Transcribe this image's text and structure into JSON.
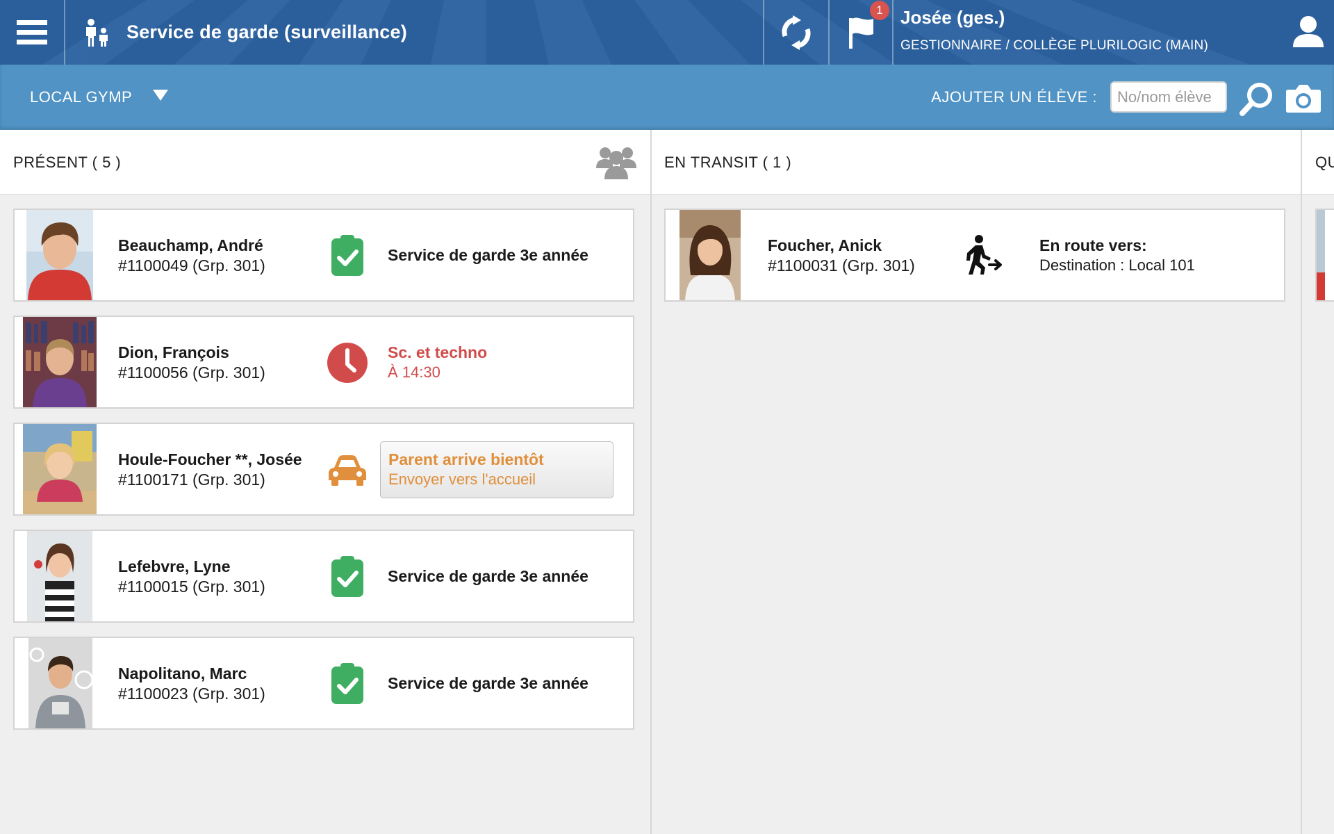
{
  "header": {
    "app_title": "Service de garde (surveillance)",
    "notification_count": "1",
    "user_name": "Josée (ges.)",
    "user_role": "GESTIONNAIRE / COLLÈGE PLURILOGIC (MAIN)"
  },
  "toolbar": {
    "location": "LOCAL GYMP",
    "add_student_label": "AJOUTER UN ÉLÈVE :",
    "student_placeholder": "No/nom élève"
  },
  "columns": {
    "present_title": "PRÉSENT ( 5 )",
    "transit_title": "EN TRANSIT ( 1 )",
    "third_title": "QU"
  },
  "present": [
    {
      "name": "Beauchamp, André",
      "number": "#1100049 (Grp. 301)",
      "status": "Service de garde 3e année"
    },
    {
      "name": "Dion, François",
      "number": "#1100056 (Grp. 301)",
      "status_line1": "Sc. et techno",
      "status_line2": "À 14:30"
    },
    {
      "name": "Houle-Foucher **, Josée",
      "number": "#1100171 (Grp. 301)",
      "button_line1": "Parent arrive bientôt",
      "button_line2": "Envoyer vers l'accueil"
    },
    {
      "name": "Lefebvre, Lyne",
      "number": "#1100015 (Grp. 301)",
      "status": "Service de garde 3e année"
    },
    {
      "name": "Napolitano, Marc",
      "number": "#1100023 (Grp. 301)",
      "status": "Service de garde 3e année"
    }
  ],
  "transit": [
    {
      "name": "Foucher, Anick",
      "number": "#1100031 (Grp. 301)",
      "status_line1": "En route vers:",
      "status_line2": "Destination : Local 101"
    }
  ],
  "colors": {
    "topbar": "#2b5f9b",
    "subbar": "#5093c4",
    "status_green": "#3fae62",
    "status_red": "#d24b4b",
    "status_orange": "#e08f3c"
  },
  "icons": {
    "menu": "hamburger-icon",
    "app": "parent-child-icon",
    "refresh": "refresh-icon",
    "flag": "flag-icon",
    "user": "user-icon",
    "search": "search-icon",
    "camera": "camera-icon",
    "group": "group-icon",
    "present_ok": "clipboard-check-icon",
    "late": "clock-icon",
    "parent": "car-icon",
    "transit": "walking-arrow-icon"
  }
}
